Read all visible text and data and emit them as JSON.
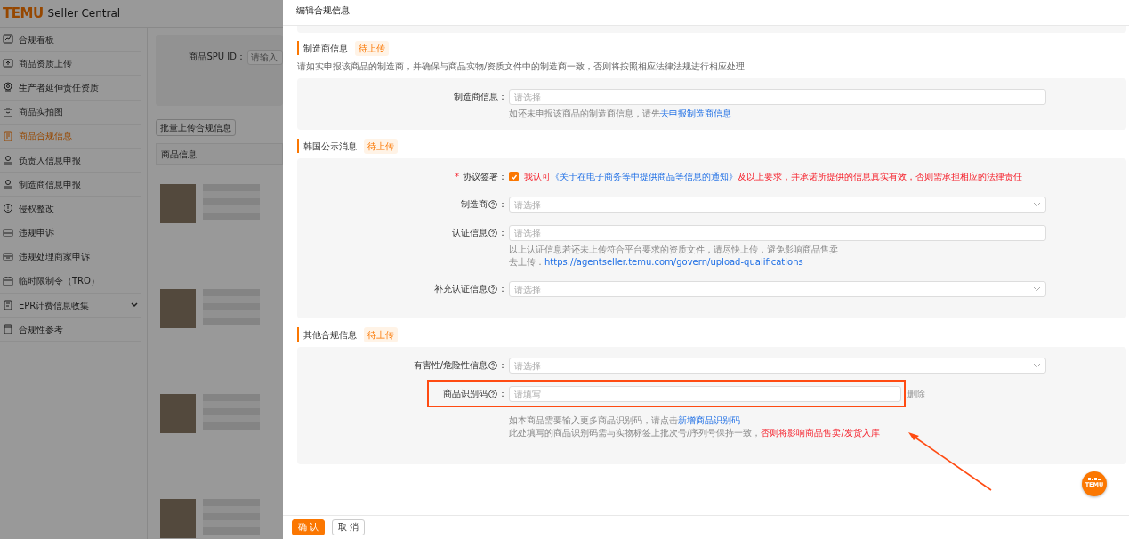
{
  "background": {
    "brand": {
      "logo": "TEMU",
      "name": "Seller Central"
    },
    "sidebar": {
      "items": [
        {
          "label": "合规看板",
          "selected": false,
          "has_children": false
        },
        {
          "label": "商品资质上传",
          "selected": false,
          "has_children": false
        },
        {
          "label": "生产者延伸责任资质",
          "selected": false,
          "has_children": false
        },
        {
          "label": "商品实拍图",
          "selected": false,
          "has_children": false
        },
        {
          "label": "商品合规信息",
          "selected": true,
          "has_children": false
        },
        {
          "label": "负责人信息申报",
          "selected": false,
          "has_children": false
        },
        {
          "label": "制造商信息申报",
          "selected": false,
          "has_children": false
        },
        {
          "label": "侵权整改",
          "selected": false,
          "has_children": false
        },
        {
          "label": "违规申诉",
          "selected": false,
          "has_children": false
        },
        {
          "label": "违规处理商家申诉",
          "selected": false,
          "has_children": false
        },
        {
          "label": "临时限制令（TRO）",
          "selected": false,
          "has_children": false
        },
        {
          "label": "EPR计费信息收集",
          "selected": false,
          "has_children": true
        },
        {
          "label": "合规性参考",
          "selected": false,
          "has_children": false
        }
      ]
    },
    "filter": {
      "label": "商品SPU ID：",
      "placeholder": "请输入"
    },
    "bulk_button": "批量上传合规信息",
    "table": {
      "columns": [
        "商品信息"
      ]
    }
  },
  "drawer": {
    "title": "编辑合规信息",
    "sections": [
      {
        "title": "制造商信息",
        "status": "待上传",
        "note": "请如实申报该商品的制造商，并确保与商品实物/资质文件中的制造商一致，否则将按照相应法律法规进行相应处理",
        "fields": [
          {
            "kind": "select",
            "label": "制造商信息：",
            "help": false,
            "placeholder": "请选择",
            "dropdown": false,
            "highlighted": false,
            "hints": [
              [
                {
                  "text": "如还未申报该商品的制造商信息，请先",
                  "kind": "muted"
                },
                {
                  "text": "去申报制造商信息",
                  "kind": "link"
                }
              ]
            ]
          }
        ]
      },
      {
        "title": "韩国公示消息",
        "status": "待上传",
        "fields": [
          {
            "kind": "checkbox",
            "required_mark": "*",
            "label": "协议签署：",
            "help": false,
            "checked": true,
            "agreement": [
              {
                "text": "我认可",
                "kind": "danger"
              },
              {
                "text": "《关于在电子商务等中提供商品等信息的通知》",
                "kind": "link"
              },
              {
                "text": "及以上要求，并承诺所提供的信息真实有效，否则需承担相应的法律责任",
                "kind": "danger"
              }
            ]
          },
          {
            "kind": "select",
            "label": "制造商",
            "help": true,
            "colon": "：",
            "placeholder": "请选择",
            "dropdown": true,
            "highlighted": false
          },
          {
            "kind": "select",
            "label": "认证信息",
            "help": true,
            "colon": "：",
            "placeholder": "请选择",
            "dropdown": false,
            "highlighted": false,
            "hints": [
              [
                {
                  "text": "以上认证信息若还未上传符合平台要求的资质文件，请尽快上传，避免影响商品售卖",
                  "kind": "muted"
                }
              ],
              [
                {
                  "text": "去上传：",
                  "kind": "muted"
                },
                {
                  "text": "https://agentseller.temu.com/govern/upload-qualifications",
                  "kind": "link"
                }
              ]
            ]
          },
          {
            "kind": "select",
            "label": "补充认证信息",
            "help": true,
            "colon": "：",
            "placeholder": "请选择",
            "dropdown": true,
            "highlighted": false
          }
        ]
      },
      {
        "title": "其他合规信息",
        "status": "待上传",
        "fields": [
          {
            "kind": "select",
            "label": "有害性/危险性信息",
            "help": true,
            "colon": "：",
            "placeholder": "请选择",
            "dropdown": true,
            "highlighted": false
          },
          {
            "kind": "input",
            "label": "商品识别码",
            "help": true,
            "colon": "：",
            "placeholder": "请填写",
            "highlighted": true,
            "action": "删除",
            "hints": [
              [
                {
                  "text": "如本商品需要输入更多商品识别码，请点击",
                  "kind": "muted"
                },
                {
                  "text": "新增商品识别码",
                  "kind": "link"
                }
              ],
              [
                {
                  "text": "此处填写的商品识别码需与实物标签上批次号/序列号保持一致，",
                  "kind": "muted"
                },
                {
                  "text": "否则将影响商品售卖/发货入库",
                  "kind": "danger"
                }
              ]
            ]
          }
        ]
      }
    ],
    "buttons": [
      {
        "label": "确 认",
        "primary": true
      },
      {
        "label": "取 消",
        "primary": false
      }
    ]
  },
  "float_button": {
    "label": "TEMU"
  }
}
